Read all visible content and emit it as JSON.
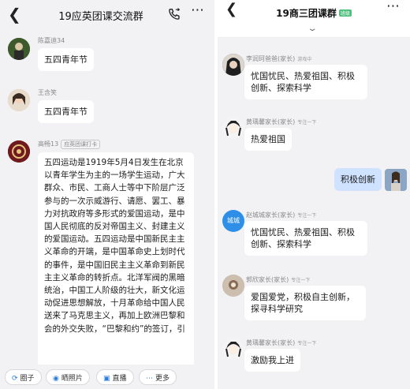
{
  "left": {
    "title": "19应英团课交流群",
    "messages": [
      {
        "name": "陈嘉迪34",
        "text": "五四青年节"
      },
      {
        "name": "王含笑",
        "text": "五四青年节"
      },
      {
        "name": "高畅13",
        "badge": "应英团课打卡",
        "text": "五四运动是1919年5月4日发生在北京以青年学生为主的一场学生运动，广大群众、市民、工商人士等中下阶层广泛参与的一次示威游行、请愿、罢工、暴力对抗政府等多形式的爱国运动，是中国人民彻底的反对帝国主义、封建主义的爱国运动。五四运动是中国新民主主义革命的开端，是中国革命史上划时代的事件，是中国旧民主主义革命到新民主主义革命的转折点。北洋军阀的黑暗统治，中国工人阶级的壮大，新文化运动促进思想解放，十月革命给中国人民送来了马克思主义，再加上欧洲巴黎和会的外交失败，“巴黎和约”的签订，引"
      }
    ],
    "toolbar": [
      {
        "icon": "circle-icon",
        "glyph": "⟳",
        "label": "圈子"
      },
      {
        "icon": "camera-icon",
        "glyph": "◉",
        "label": "晒照片"
      },
      {
        "icon": "book-icon",
        "glyph": "▣",
        "label": "直播"
      },
      {
        "icon": "more-icon",
        "glyph": "⋯",
        "label": "更多"
      }
    ]
  },
  "right": {
    "title": "19商三团课群",
    "title_tag": "班级",
    "messages": [
      {
        "name": "李润珂爸爸(家长)",
        "status": "游戏中",
        "text": "忧国忧民、热爱祖国、积极创新、探索科学"
      },
      {
        "name": "黄瑀馨家长(家长)",
        "status": "专注一下",
        "text": "热爱祖国"
      },
      {
        "self": true,
        "text": "积极创新"
      },
      {
        "name": "赵城城家长(家长)",
        "avatar_text": "城城",
        "status": "专注一下",
        "text": "忧国忧民、热爱祖国、积极创新、探索科学"
      },
      {
        "name": "郭欣家长(家长)",
        "status": "专注一下",
        "text": "爱国爱党，积极自主创新，探寻科学研究"
      },
      {
        "name": "黄瑀馨家长(家长)",
        "status": "专注一下",
        "text": "激励我上进"
      }
    ]
  },
  "colors": {
    "panel_bg": "#f2f2f4",
    "self_bubble": "#cfe2ff",
    "accent": "#2a7be0",
    "avatar_blue": "#2f8fe8"
  }
}
